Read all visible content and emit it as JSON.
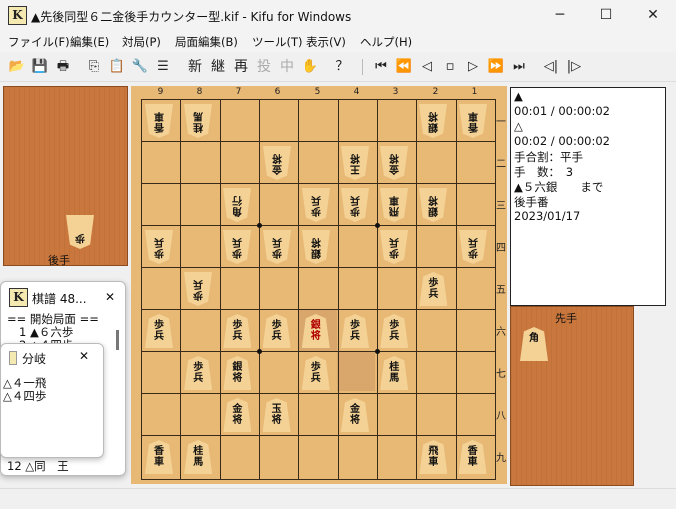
{
  "window": {
    "title": "▲先後同型６二金後手カウンター型.kif - Kifu for Windows",
    "app_icon_text": "K",
    "minimize": "─",
    "maximize": "☐",
    "close": "✕"
  },
  "menu": [
    "ファイル(F)",
    "編集(E)",
    "対局(P)",
    "局面編集(B)",
    "ツール(T)",
    "表示(V)",
    "ヘルプ(H)"
  ],
  "toolbar": {
    "open": "📂",
    "save": "💾",
    "print": "🖶",
    "copy": "⎘",
    "paste": "📋",
    "tool": "🔧",
    "list": "☰",
    "new": "新",
    "continue": "継",
    "again": "再",
    "resign": "投",
    "interrupt": "中",
    "hand": "✋",
    "help": "？",
    "first": "⏮",
    "back10": "⏪",
    "prev": "◁",
    "stop": "▫",
    "next": "▷",
    "fwd10": "⏩",
    "last": "⏭",
    "branch_prev": "◁|",
    "branch_next": "|▷"
  },
  "board": {
    "columns": [
      "9",
      "8",
      "7",
      "6",
      "5",
      "4",
      "3",
      "2",
      "1"
    ],
    "rows": [
      "一",
      "二",
      "三",
      "四",
      "五",
      "六",
      "七",
      "八",
      "九"
    ],
    "gote_label": "後手",
    "sente_label": "先手",
    "gote_hand": [
      "歩"
    ],
    "sente_hand": [
      "角"
    ]
  },
  "info": {
    "lines": [
      "▲",
      "00:01 / 00:00:02",
      "△",
      "00:02 / 00:00:02",
      "手合割：平手",
      "手　数：　3",
      "▲５六銀　　まで",
      "後手番",
      "2023/01/17"
    ]
  },
  "kifu_window": {
    "title": "棋譜 48...",
    "close": "✕",
    "lines": [
      "== 開始局面 ==",
      "1 ▲６六歩",
      "2 △４四歩"
    ],
    "bottom_line": "12 △同　王"
  },
  "branch_window": {
    "title": "分岐",
    "close": "✕",
    "items": [
      "△４一飛",
      "△４四歩"
    ]
  }
}
